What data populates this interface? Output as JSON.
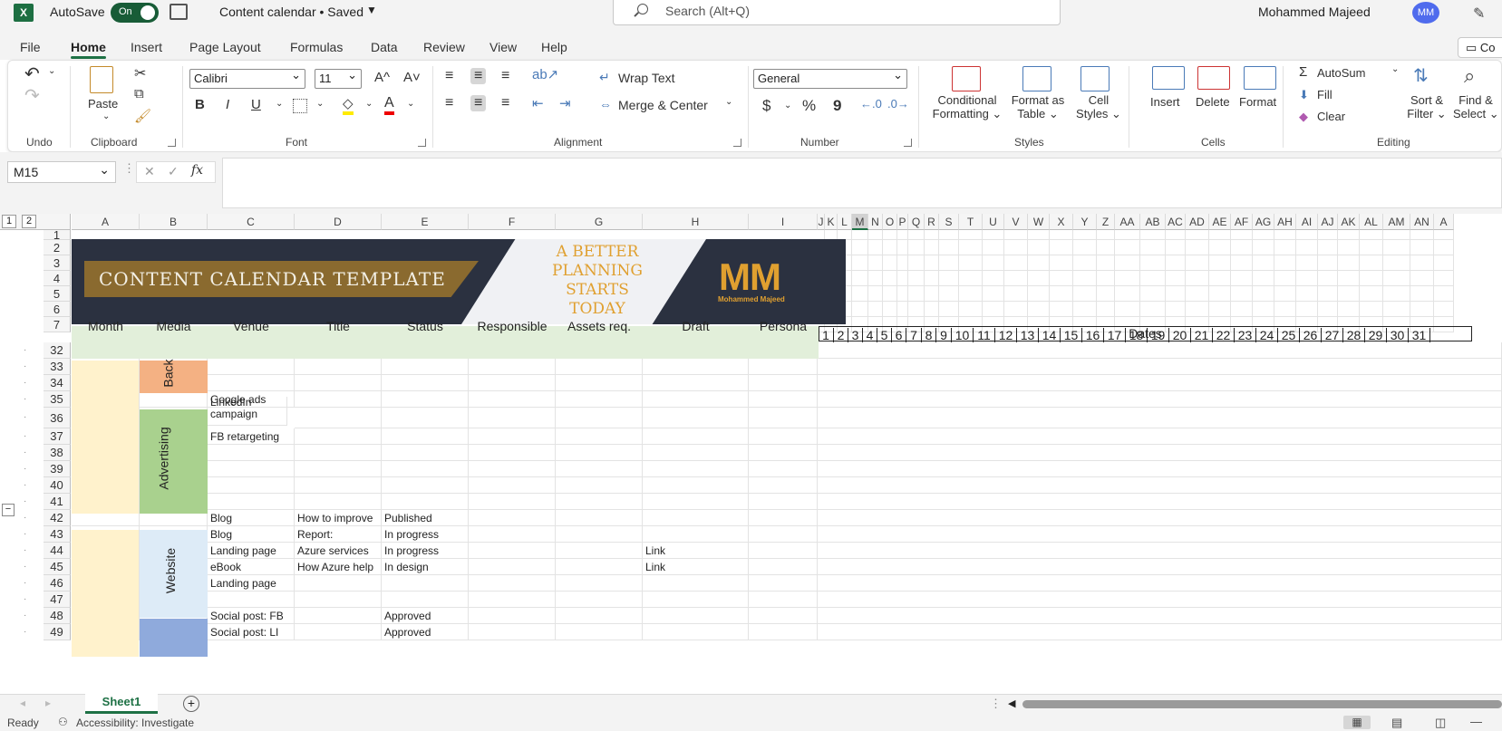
{
  "titlebar": {
    "autosave_label": "AutoSave",
    "autosave_state": "On",
    "doc_title": "Content calendar • Saved",
    "search_placeholder": "Search (Alt+Q)",
    "user_name": "Mohammed Majeed",
    "user_initials": "MM"
  },
  "menu_tabs": [
    "File",
    "Home",
    "Insert",
    "Page Layout",
    "Formulas",
    "Data",
    "Review",
    "View",
    "Help"
  ],
  "comments_label": "Co",
  "ribbon": {
    "groups": {
      "undo": "Undo",
      "clipboard": "Clipboard",
      "font": "Font",
      "alignment": "Alignment",
      "number": "Number",
      "styles": "Styles",
      "cells": "Cells",
      "editing": "Editing"
    },
    "paste": "Paste",
    "font_name": "Calibri",
    "font_size": "11",
    "grow_font": "A^",
    "shrink_font": "A˅",
    "bold": "B",
    "italic": "I",
    "underline": "U",
    "wrap_text": "Wrap Text",
    "merge_center": "Merge & Center",
    "number_format": "General",
    "currency": "$",
    "percent": "%",
    "comma": "9",
    "conditional_formatting": [
      "Conditional",
      "Formatting"
    ],
    "format_as_table": [
      "Format as",
      "Table"
    ],
    "cell_styles": [
      "Cell",
      "Styles"
    ],
    "insert": "Insert",
    "delete": "Delete",
    "format": "Format",
    "autosum": "AutoSum",
    "fill": "Fill",
    "clear": "Clear",
    "sort_filter": [
      "Sort &",
      "Filter"
    ],
    "find_select": [
      "Find &",
      "Select"
    ]
  },
  "formula_bar": {
    "name_box": "M15",
    "fx": "fx",
    "formula": ""
  },
  "outline_levels": [
    "1",
    "2"
  ],
  "columns": [
    "A",
    "B",
    "C",
    "D",
    "E",
    "F",
    "G",
    "H",
    "I",
    "J",
    "K",
    "L",
    "M",
    "N",
    "O",
    "P",
    "Q",
    "R",
    "S",
    "T",
    "U",
    "V",
    "W",
    "X",
    "Y",
    "Z",
    "AA",
    "AB",
    "AC",
    "AD",
    "AE",
    "AF",
    "AG",
    "AH",
    "AI",
    "AJ",
    "AK",
    "AL",
    "AM",
    "AN",
    "A"
  ],
  "banner": {
    "title": "CONTENT CALENDAR TEMPLATE",
    "slogan": [
      "A BETTER",
      "PLANNING",
      "STARTS",
      "TODAY"
    ],
    "logo_mark": "MM",
    "logo_name": "Mohammed Majeed"
  },
  "headers": [
    "Month",
    "Media",
    "Venue",
    "Title",
    "Status",
    "Responsible",
    "Assets req.",
    "Draft",
    "Persona"
  ],
  "dates_label": "Dates",
  "day_numbers": [
    "1",
    "2",
    "3",
    "4",
    "5",
    "6",
    "7",
    "8",
    "9",
    "10",
    "11",
    "12",
    "13",
    "14",
    "15",
    "16",
    "17",
    "18",
    "19",
    "20",
    "21",
    "22",
    "23",
    "24",
    "25",
    "26",
    "27",
    "28",
    "29",
    "30",
    "31"
  ],
  "rows": [
    {
      "num": "1"
    },
    {
      "num": "2"
    },
    {
      "num": "3"
    },
    {
      "num": "4"
    },
    {
      "num": "5"
    },
    {
      "num": "6"
    },
    {
      "num": "7"
    },
    {
      "num": "32"
    },
    {
      "num": "33"
    },
    {
      "num": "34"
    },
    {
      "num": "35",
      "venue": "Google ads"
    },
    {
      "num": "36",
      "venue": "LinkedIn campaign"
    },
    {
      "num": "37",
      "venue": "FB retargeting"
    },
    {
      "num": "38"
    },
    {
      "num": "39"
    },
    {
      "num": "40"
    },
    {
      "num": "41"
    },
    {
      "num": "42",
      "venue": "Blog",
      "title": "How to improve",
      "status": "Published"
    },
    {
      "num": "43",
      "venue": "Blog",
      "title": "Report:",
      "status": "In progress"
    },
    {
      "num": "44",
      "venue": "Landing page",
      "title": "Azure services",
      "status": "In progress",
      "draft": "Link"
    },
    {
      "num": "45",
      "venue": "eBook",
      "title": "How Azure help",
      "status": "In design",
      "draft": "Link"
    },
    {
      "num": "46",
      "venue": "Landing page"
    },
    {
      "num": "47"
    },
    {
      "num": "48",
      "venue": "Social post: FB",
      "status": "Approved"
    },
    {
      "num": "49",
      "venue": "Social post: LI",
      "status": "Approved"
    }
  ],
  "media_labels": {
    "back": "Back",
    "advertising": "Advertising",
    "website": "Website"
  },
  "sheet_tab": "Sheet1",
  "status": {
    "ready": "Ready",
    "accessibility": "Accessibility: Investigate"
  },
  "colors": {
    "excel_green": "#1d6f42",
    "header_green": "#e2efda",
    "month_fill": "#fff2cc",
    "back_fill": "#f4b183",
    "adv_fill": "#a9d18e",
    "web_fill": "#ddebf7",
    "social_fill": "#8faadc",
    "banner_dark": "#2b3140",
    "banner_gold": "#e0a030"
  }
}
